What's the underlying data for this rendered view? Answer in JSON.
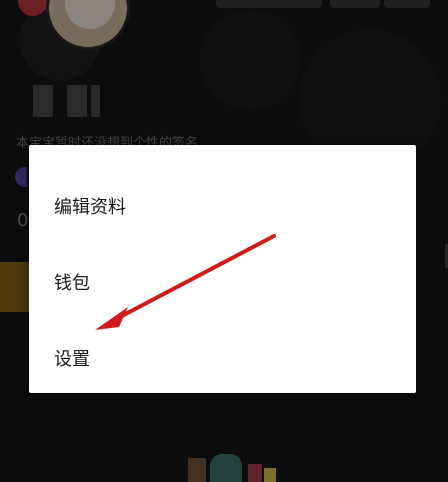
{
  "profile": {
    "signature_text": "本宝宝暂时还没想到个性的签名",
    "stat_value": "0"
  },
  "menu": {
    "items": [
      {
        "label": "编辑资料"
      },
      {
        "label": "钱包"
      },
      {
        "label": "设置"
      }
    ]
  },
  "colors": {
    "annotation_arrow": "#d11a1a",
    "dialog_background": "#ffffff",
    "overlay": "#000000"
  },
  "icons": {
    "arrow": "red-arrow-annotation-icon"
  }
}
